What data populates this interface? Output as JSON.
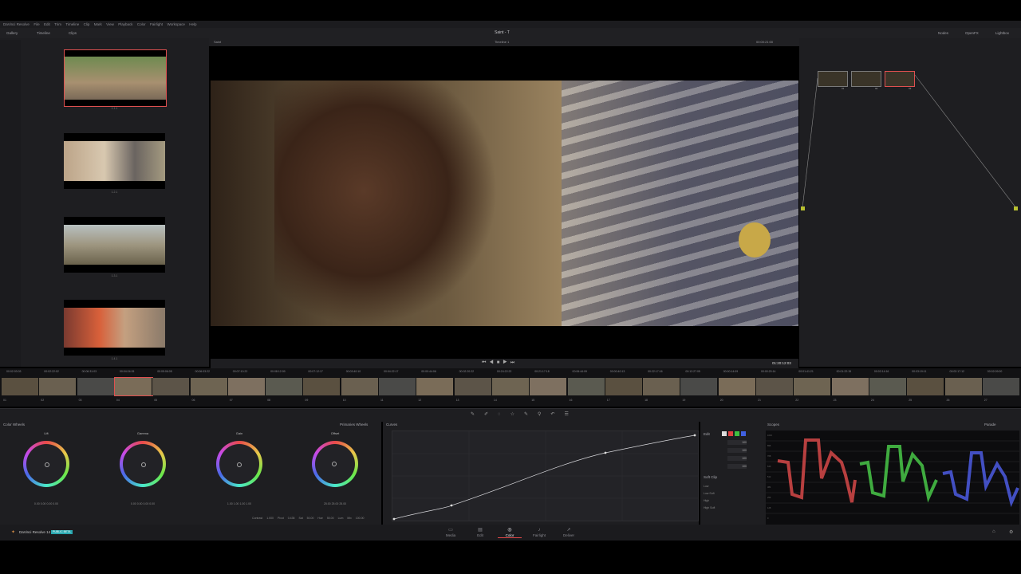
{
  "app": {
    "menu": [
      "DaVinci Resolve",
      "File",
      "Edit",
      "Trim",
      "Timeline",
      "Clip",
      "Mark",
      "View",
      "Playback",
      "Color",
      "Fairlight",
      "Workspace",
      "Help"
    ],
    "project_title": "Saint - T",
    "toolbar": {
      "gallery_label": "Gallery",
      "timeline_label": "Timeline",
      "clips_label": "Clips",
      "nodes_label": "Nodes",
      "openfx_label": "OpenFX",
      "lightbox_label": "Lightbox"
    }
  },
  "viewer": {
    "tab_label": "Saint",
    "timeline_name": "Timeline 1",
    "zoom": "Clip",
    "timecode": "01:20:12:03",
    "source_tc": "00:00:21:00"
  },
  "gallery": {
    "stills": [
      "1.1.1",
      "1.2.1",
      "1.3.1",
      "1.4.1"
    ]
  },
  "nodes": {
    "items": [
      "01",
      "02",
      "03"
    ]
  },
  "clips": [
    {
      "num": "01",
      "tc": "00:02:03:03"
    },
    {
      "num": "02",
      "tc": "00:02:22:02"
    },
    {
      "num": "03",
      "tc": "00:06:31:03"
    },
    {
      "num": "04",
      "tc": "00:04:24:15"
    },
    {
      "num": "05",
      "tc": "00:05:06:05"
    },
    {
      "num": "06",
      "tc": "00:06:03:22"
    },
    {
      "num": "07",
      "tc": "00:07:10:22"
    },
    {
      "num": "08",
      "tc": "00:08:12:09"
    },
    {
      "num": "09",
      "tc": "00:07:12:17"
    },
    {
      "num": "10",
      "tc": "00:03:40:10"
    },
    {
      "num": "11",
      "tc": "00:04:22:17"
    },
    {
      "num": "12",
      "tc": "00:00:44:06"
    },
    {
      "num": "13",
      "tc": "00:02:20:22"
    },
    {
      "num": "14",
      "tc": "00:24:22:22"
    },
    {
      "num": "15",
      "tc": "00:21:17:18"
    },
    {
      "num": "16",
      "tc": "00:06:44:09"
    },
    {
      "num": "17",
      "tc": "00:00:40:13"
    },
    {
      "num": "18",
      "tc": "00:22:17:16"
    },
    {
      "num": "19",
      "tc": "00:12:27:05"
    },
    {
      "num": "20",
      "tc": "00:00:14:09"
    },
    {
      "num": "21",
      "tc": "00:00:20:14"
    },
    {
      "num": "22",
      "tc": "00:01:41:21"
    },
    {
      "num": "23",
      "tc": "00:01:22:15"
    },
    {
      "num": "24",
      "tc": "00:02:14:16"
    },
    {
      "num": "25",
      "tc": "00:03:19:11"
    },
    {
      "num": "26",
      "tc": "00:02:17:12"
    },
    {
      "num": "27",
      "tc": "00:02:09:00"
    }
  ],
  "color_wheels": {
    "title": "Color Wheels",
    "mode": "Primaries Wheels",
    "wheels": [
      {
        "label": "Lift",
        "values": "0.00  0.00  0.00  0.00"
      },
      {
        "label": "Gamma",
        "values": "0.00  0.00  0.00  0.00"
      },
      {
        "label": "Gain",
        "values": "1.00  1.00  1.00  1.00"
      },
      {
        "label": "Offset",
        "values": "25.00  25.00  25.00"
      }
    ],
    "footer": {
      "contrast": "Contrast 1.000",
      "pivot": "Pivot 0.435",
      "sat": "Sat 50.00",
      "hue": "Hue 50.00",
      "lum_mix": "Lum Mix 100.00"
    }
  },
  "curves": {
    "title": "Curves",
    "mode": "Custom",
    "edit_label": "Edit",
    "soft_clip": "Soft Clip",
    "soft_rows": [
      "Low",
      "Low Soft",
      "High",
      "High Soft"
    ],
    "channel_vals": [
      "100",
      "100",
      "100",
      "100"
    ]
  },
  "scopes": {
    "title": "Scopes",
    "mode": "Parade",
    "scale": [
      "1023",
      "896",
      "768",
      "640",
      "512",
      "384",
      "256",
      "128",
      "0"
    ]
  },
  "pages": [
    {
      "label": "Media",
      "icon": "▭"
    },
    {
      "label": "Edit",
      "icon": "▤"
    },
    {
      "label": "Color",
      "icon": "◎"
    },
    {
      "label": "Fairlight",
      "icon": "♪"
    },
    {
      "label": "Deliver",
      "icon": "➚"
    }
  ],
  "footer": {
    "product": "DaVinci Resolve 14",
    "badge": "PUBLIC BETA"
  },
  "colors": {
    "accent_red": "#e04848",
    "badge_cyan": "#2aa8b0",
    "panel": "#1e1e21"
  }
}
